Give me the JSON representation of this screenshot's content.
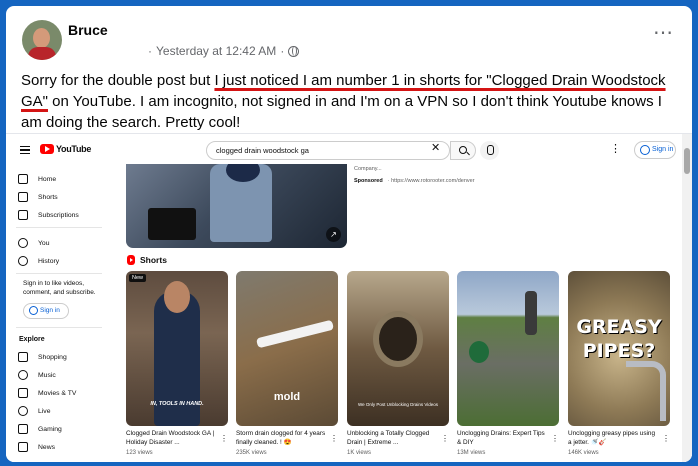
{
  "post": {
    "author": "Bruce",
    "timestamp": "Yesterday at 12:42 AM",
    "separator": "·",
    "more_icon": "⋯",
    "text_before": "Sorry for the double post but ",
    "text_highlight": "I just noticed I am number 1 in shorts for \"Clogged Drain Woodstock GA\"",
    "text_after": " on YouTube. I am incognito, not signed in and I'm on a VPN so I don't think Youtube knows I am doing the search. Pretty cool!",
    "colors": {
      "highlight_underline": "#d41414",
      "background": "#1565c0"
    }
  },
  "youtube": {
    "logo_text": "YouTube",
    "search_value": "clogged drain woodstock ga",
    "clear_icon": "✕",
    "dots_icon": "⋮",
    "sign_in": "Sign in",
    "nav": [
      {
        "label": "Home",
        "icon": "home-icon"
      },
      {
        "label": "Shorts",
        "icon": "shorts-icon"
      },
      {
        "label": "Subscriptions",
        "icon": "subscriptions-icon"
      },
      {
        "label": "You",
        "icon": "you-icon"
      },
      {
        "label": "History",
        "icon": "history-icon"
      }
    ],
    "sign_in_message": "Sign in to like videos, comment, and subscribe.",
    "nav_sign_in": "Sign in",
    "explore_heading": "Explore",
    "explore": [
      {
        "label": "Shopping",
        "icon": "shopping-icon"
      },
      {
        "label": "Music",
        "icon": "music-icon"
      },
      {
        "label": "Movies & TV",
        "icon": "movies-icon"
      },
      {
        "label": "Live",
        "icon": "live-icon"
      },
      {
        "label": "Gaming",
        "icon": "gaming-icon"
      },
      {
        "label": "News",
        "icon": "news-icon"
      }
    ],
    "ad": {
      "company": "Company...",
      "sponsored": "Sponsored",
      "url": "· https://www.rotorooter.com/denver",
      "chevron": "↗"
    },
    "shorts_heading": "Shorts",
    "shorts": [
      {
        "title": "Clogged Drain Woodstock GA | Holiday Disaster ...",
        "views": "123 views",
        "badge": "New",
        "overlay": "IN, TOOLS IN HAND."
      },
      {
        "title": "Storm drain clogged for 4 years finally cleaned. ! 😍",
        "views": "235K views",
        "overlay": "mold"
      },
      {
        "title": "Unblocking a Totally Clogged Drain | Extreme ...",
        "views": "1K views",
        "overlay": "We Only Post Unblocking Drains Videos"
      },
      {
        "title": "Unclogging Drains: Expert Tips & DIY",
        "views": "13M views"
      },
      {
        "title": "Unclogging greasy pipes using a jetter. 🚿🎸",
        "views": "146K views",
        "overlay": "GREASY PIPES?"
      }
    ],
    "kebab": "⋮"
  }
}
